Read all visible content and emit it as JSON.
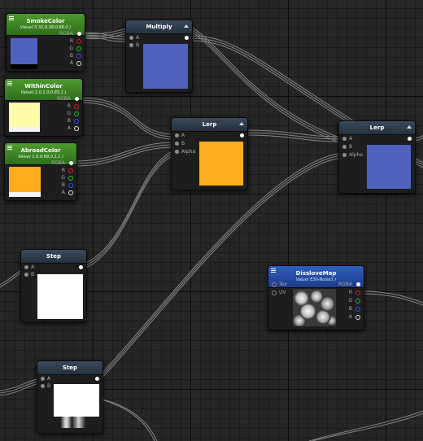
{
  "nodes": {
    "smoke_color": {
      "title": "SmokeColor",
      "subtitle": "Value( 0.32,0.39,0.68,0 )",
      "color": "#4f62bd",
      "outputs": [
        "RGBA",
        "R",
        "G",
        "B",
        "A"
      ]
    },
    "within_color": {
      "title": "WithinColor",
      "subtitle": "Value( 1.0,1.0,0.65,1 )",
      "color": "#fffaa8",
      "outputs": [
        "RGBA",
        "R",
        "G",
        "B",
        "A"
      ]
    },
    "abroad_color": {
      "title": "AbroadColor",
      "subtitle": "Value( 1.0,0.69,0.1,1 )",
      "color": "#ffad1c",
      "outputs": [
        "RGBA",
        "R",
        "G",
        "B",
        "A"
      ]
    },
    "multiply": {
      "title": "Multiply",
      "inputs": [
        "A",
        "B"
      ],
      "color": "#4f62bd"
    },
    "lerp_1": {
      "title": "Lerp",
      "inputs": [
        "A",
        "B",
        "Alpha"
      ],
      "color": "#ffad1c"
    },
    "lerp_2": {
      "title": "Lerp",
      "inputs": [
        "A",
        "B",
        "Alpha"
      ],
      "color": "#4f62bd"
    },
    "step_1": {
      "title": "Step",
      "inputs": [
        "A",
        "B"
      ],
      "color": "#ffffff"
    },
    "step_2": {
      "title": "Step",
      "inputs": [
        "A",
        "B"
      ],
      "color": "#ffffff"
    },
    "dissolve_map": {
      "title": "DissloveMap",
      "subtitle": "Value( E30-Noise3 )",
      "inputs": [
        "Tex",
        "UV"
      ],
      "outputs": [
        "RGBA",
        "R",
        "G",
        "B",
        "A"
      ]
    }
  },
  "colors": {
    "canvas": "#262626",
    "wire": "#9a9a9a",
    "header_green": "#3f8a26",
    "header_blue": "#2a55b0",
    "header_gray": "#2e3b48"
  }
}
